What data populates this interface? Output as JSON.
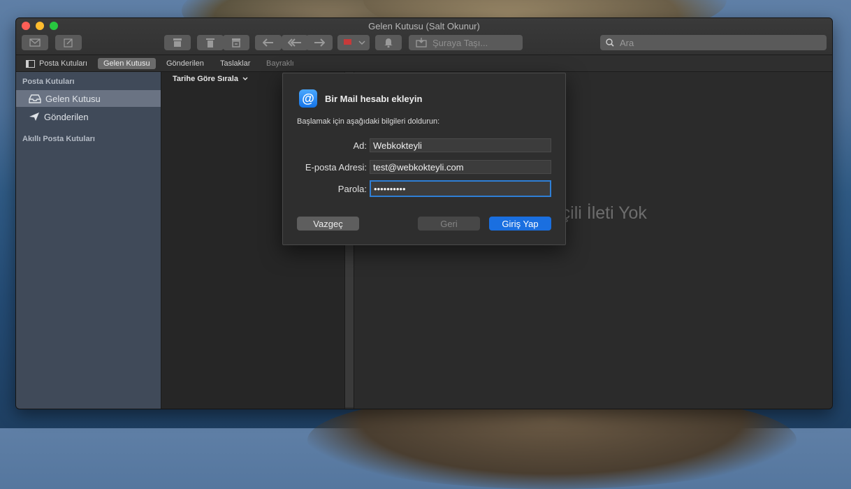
{
  "window": {
    "title": "Gelen Kutusu (Salt Okunur)"
  },
  "toolbar": {
    "buttons": [
      {
        "name": "envelope-icon"
      },
      {
        "name": "compose-icon"
      },
      {
        "name": "archive-icon"
      },
      {
        "name": "trash-icon"
      },
      {
        "name": "junk-icon"
      },
      {
        "name": "reply-icon"
      },
      {
        "name": "reply-all-icon"
      },
      {
        "name": "forward-icon"
      },
      {
        "name": "flag-icon"
      },
      {
        "name": "bell-icon"
      }
    ],
    "move_label": "Şuraya Taşı...",
    "search_placeholder": "Ara",
    "flag_color": "#c63a3a"
  },
  "favorites": {
    "mailboxes_label": "Posta Kutuları",
    "items": [
      "Gelen Kutusu",
      "Gönderilen",
      "Taslaklar",
      "Bayraklı"
    ]
  },
  "sidebar": {
    "section1": "Posta Kutuları",
    "items": [
      {
        "label": "Gelen Kutusu",
        "icon": "inbox-icon"
      },
      {
        "label": "Gönderilen",
        "icon": "sent-icon"
      }
    ],
    "section2": "Akıllı Posta Kutuları"
  },
  "list": {
    "sort_label": "Tarihe Göre Sırala"
  },
  "content": {
    "empty_text": "Seçili İleti Yok"
  },
  "dialog": {
    "title": "Bir Mail hesabı ekleyin",
    "instructions": "Başlamak için aşağıdaki bilgileri doldurun:",
    "fields": {
      "name_label": "Ad:",
      "name_value": "Webkokteyli",
      "email_label": "E-posta Adresi:",
      "email_value": "test@webkokteyli.com",
      "password_label": "Parola:",
      "password_value": "••••••••••"
    },
    "buttons": {
      "cancel": "Vazgeç",
      "back": "Geri",
      "login": "Giriş Yap"
    },
    "accent_color": "#1a6fe0"
  }
}
